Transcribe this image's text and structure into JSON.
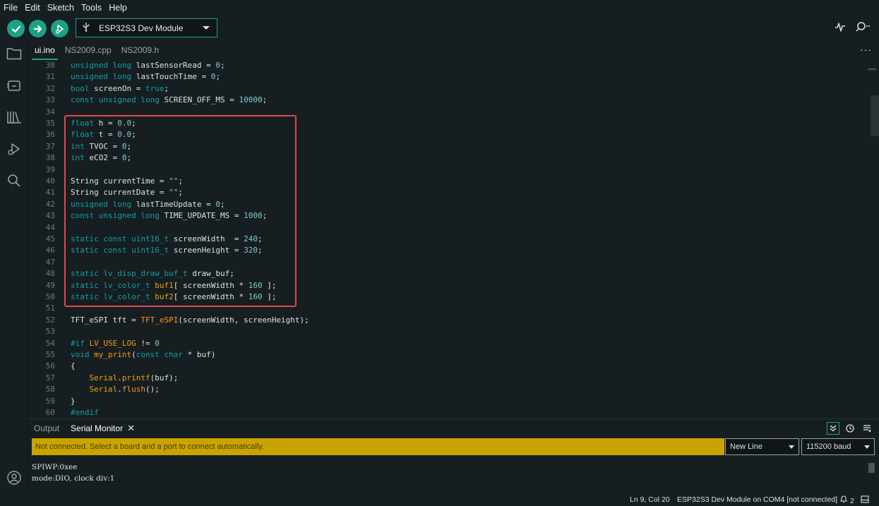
{
  "menu": [
    "File",
    "Edit",
    "Sketch",
    "Tools",
    "Help"
  ],
  "toolbar": {
    "board": "ESP32S3 Dev Module",
    "verify_icon": "checkmark-icon",
    "upload_icon": "arrow-right-icon",
    "debug_icon": "debugger-icon",
    "plotter_icon": "serial-plotter-icon",
    "monitor_icon": "serial-monitor-icon"
  },
  "tabs": [
    {
      "label": "ui.ino",
      "active": true
    },
    {
      "label": "NS2009.cpp",
      "active": false
    },
    {
      "label": "NS2009.h",
      "active": false
    }
  ],
  "tabs_more": "···",
  "code": {
    "lines": [
      {
        "n": "30",
        "html": "<span class='kw'>unsigned</span> <span class='kw'>long</span> lastSensorRead = <span class='num'>0</span>;"
      },
      {
        "n": "31",
        "html": "<span class='kw'>unsigned</span> <span class='kw'>long</span> lastTouchTime = <span class='num'>0</span>;"
      },
      {
        "n": "32",
        "html": "<span class='kw'>bool</span> screenOn = <span class='kw'>true</span>;"
      },
      {
        "n": "33",
        "html": "<span class='kw'>const</span> <span class='kw'>unsigned</span> <span class='kw'>long</span> SCREEN_OFF_MS = <span class='num'>10000</span>;"
      },
      {
        "n": "34",
        "html": ""
      },
      {
        "n": "35",
        "html": "<span class='kw'>float</span> h = <span class='num'>0.0</span>;"
      },
      {
        "n": "36",
        "html": "<span class='kw'>float</span> t = <span class='num'>0.0</span>;"
      },
      {
        "n": "37",
        "html": "<span class='kw'>int</span> TVOC = <span class='num'>0</span>;"
      },
      {
        "n": "38",
        "html": "<span class='kw'>int</span> eCO2 = <span class='num'>0</span>;"
      },
      {
        "n": "39",
        "html": ""
      },
      {
        "n": "40",
        "html": "String currentTime = <span class='str'>\"\"</span>;"
      },
      {
        "n": "41",
        "html": "String currentDate = <span class='str'>\"\"</span>;"
      },
      {
        "n": "42",
        "html": "<span class='kw'>unsigned</span> <span class='kw'>long</span> lastTimeUpdate = <span class='num'>0</span>;"
      },
      {
        "n": "43",
        "html": "<span class='kw'>const</span> <span class='kw'>unsigned</span> <span class='kw'>long</span> TIME_UPDATE_MS = <span class='num'>1000</span>;"
      },
      {
        "n": "44",
        "html": ""
      },
      {
        "n": "45",
        "html": "<span class='kw'>static</span> <span class='kw'>const</span> <span class='kw'>uint16_t</span> screenWidth  = <span class='num'>240</span>;"
      },
      {
        "n": "46",
        "html": "<span class='kw'>static</span> <span class='kw'>const</span> <span class='kw'>uint16_t</span> screenHeight = <span class='num'>320</span>;"
      },
      {
        "n": "47",
        "html": ""
      },
      {
        "n": "48",
        "html": "<span class='kw'>static</span> <span class='kw'>lv_disp_draw_buf_t</span> draw_buf;"
      },
      {
        "n": "49",
        "html": "<span class='kw'>static</span> <span class='kw'>lv_color_t</span> <span class='fn'>buf1</span>[ screenWidth * <span class='num'>160</span> ];"
      },
      {
        "n": "50",
        "html": "<span class='kw'>static</span> <span class='kw'>lv_color_t</span> <span class='fn'>buf2</span>[ screenWidth * <span class='num'>160</span> ];"
      },
      {
        "n": "51",
        "html": ""
      },
      {
        "n": "52",
        "html": "TFT_eSPI tft = <span class='fn'>TFT_eSPI</span>(screenWidth, screenHeight);"
      },
      {
        "n": "53",
        "html": ""
      },
      {
        "n": "54",
        "html": "<span class='pp2'>#if</span> <span class='fn'>LV_USE_LOG</span> != <span class='num'>0</span>"
      },
      {
        "n": "55",
        "html": "<span class='kw'>void</span> <span class='fn'>my_print</span>(<span class='kw'>const</span> <span class='kw'>char</span> * buf)"
      },
      {
        "n": "56",
        "html": "{"
      },
      {
        "n": "57",
        "html": "    <span class='fn'>Serial</span>.<span class='fn'>printf</span>(buf);"
      },
      {
        "n": "58",
        "html": "    <span class='fn'>Serial</span>.<span class='fn'>flush</span>();"
      },
      {
        "n": "59",
        "html": "}"
      },
      {
        "n": "60",
        "html": "<span class='pp2'>#endif</span>"
      }
    ]
  },
  "panel": {
    "tabs": [
      {
        "label": "Output",
        "active": false
      },
      {
        "label": "Serial Monitor",
        "active": true
      }
    ],
    "close_glyph": "✕",
    "message": "Not connected. Select a board and a port to connect automatically.",
    "line_ending": "New Line",
    "baud": "115200 baud",
    "output": [
      "SPIWP:0xee",
      "mode:DIO, clock div:1"
    ]
  },
  "status": {
    "position": "Ln 9, Col 20",
    "board_port": "ESP32S3 Dev Module on COM4 [not connected]",
    "notifications": "2"
  },
  "colors": {
    "accent": "#1da086",
    "warning": "#c9a401",
    "highlight_box": "#e0484c",
    "background": "#171e21"
  }
}
